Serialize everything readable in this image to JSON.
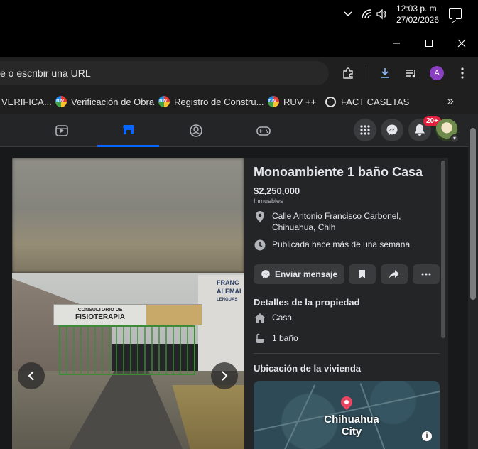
{
  "system_tray": {
    "time": "12:03 p. m.",
    "date": "27/02/2026"
  },
  "browser": {
    "omnibox_text": "e o escribir una URL",
    "profile_initial": "A",
    "bookmarks": [
      {
        "label": "VERIFICA...",
        "icon": "ruv-icon"
      },
      {
        "label": "Verificación de Obra",
        "icon": "ruv-icon"
      },
      {
        "label": "Registro de Constru...",
        "icon": "ruv-icon"
      },
      {
        "label": "RUV ++",
        "icon": "ruv-icon"
      },
      {
        "label": "FACT CASETAS",
        "icon": "globe-icon"
      }
    ],
    "more_bookmarks": "»"
  },
  "facebook": {
    "notification_badge": "20+",
    "accent_color": "#0866ff"
  },
  "listing": {
    "title": "Monoambiente 1 baño Casa",
    "price": "$2,250,000",
    "category": "Inmuebles",
    "address_line1": "Calle Antonio Francisco Carbonel,",
    "address_line2": "Chihuahua, Chih",
    "published": "Publicada hace más de una semana",
    "message_button": "Enviar mensaje",
    "details_heading": "Detalles de la propiedad",
    "property_type": "Casa",
    "bathrooms": "1 baño",
    "location_heading": "Ubicación de la vivienda",
    "map_city_line1": "Chihuahua",
    "map_city_line2": "City"
  },
  "photo": {
    "sign_line1": "CONSULTORIO DE",
    "sign_line2": "FISIOTERAPIA",
    "building_text_1": "FRANC",
    "building_text_2": "ALEMAI",
    "building_text_3": "LENGUAS"
  }
}
